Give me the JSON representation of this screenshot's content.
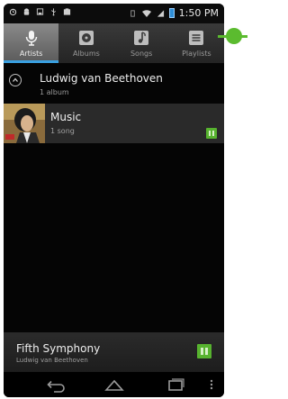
{
  "status_bar": {
    "icons": [
      "alarm-icon",
      "android-icon",
      "save-icon",
      "usb-icon",
      "image-icon",
      "vibrate-icon",
      "wifi-icon",
      "signal-icon",
      "battery-icon"
    ],
    "time": "1:50 PM"
  },
  "tabs": [
    {
      "label": "Artists",
      "icon": "microphone-icon",
      "active": true
    },
    {
      "label": "Albums",
      "icon": "disc-icon",
      "active": false
    },
    {
      "label": "Songs",
      "icon": "music-note-icon",
      "active": false
    },
    {
      "label": "Playlists",
      "icon": "playlist-icon",
      "active": false
    }
  ],
  "artist": {
    "name": "Ludwig van Beethoven",
    "count": "1 album"
  },
  "album": {
    "title": "Music",
    "count": "1 song"
  },
  "now_playing": {
    "title": "Fifth Symphony",
    "artist": "Ludwig van Beethoven"
  },
  "nav": {
    "icons": [
      "back-icon",
      "home-icon",
      "recent-apps-icon",
      "menu-icon"
    ]
  },
  "colors": {
    "accent_green": "#57b32f",
    "active_tab_underline": "#3aa0e0",
    "annotation_green": "#5bbb2f"
  }
}
